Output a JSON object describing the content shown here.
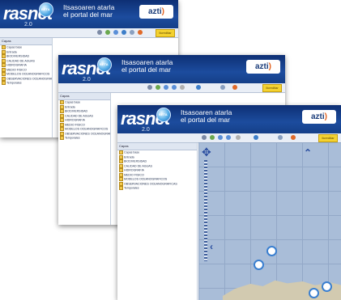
{
  "app": {
    "logo_text": "rasnet",
    "logo_version": "2.0",
    "badge": "BETA",
    "tagline_line1": "Itsasoaren atarla",
    "tagline_line2": "el portal del mar",
    "partner_logo": "azti",
    "partner_logo_mark": ")",
    "toolbar_button": "Ilcreditar"
  },
  "panel": {
    "title": "Capas",
    "layers": [
      "Capas base",
      "Entrada",
      "BIODIVERSIDAD",
      "CALIDAD DE AGUAS",
      "HIDROGRAFIA",
      "MEDIO FISICO",
      "MODELOS OCEANOGRAFICOS",
      "OBSERVACIONES OCEANOGRAFICAS",
      "Temporales"
    ]
  },
  "colors": {
    "header": "#153f88",
    "accent": "#e2611e",
    "map_sea": "#a9bdd8",
    "land": "#d2cab0",
    "toolbar_button": "#f4d230"
  },
  "icons": [
    "search-icon",
    "pan-icon",
    "zoom-in-icon",
    "zoom-out-icon",
    "measure-icon",
    "info-icon",
    "print-icon",
    "help-icon"
  ]
}
